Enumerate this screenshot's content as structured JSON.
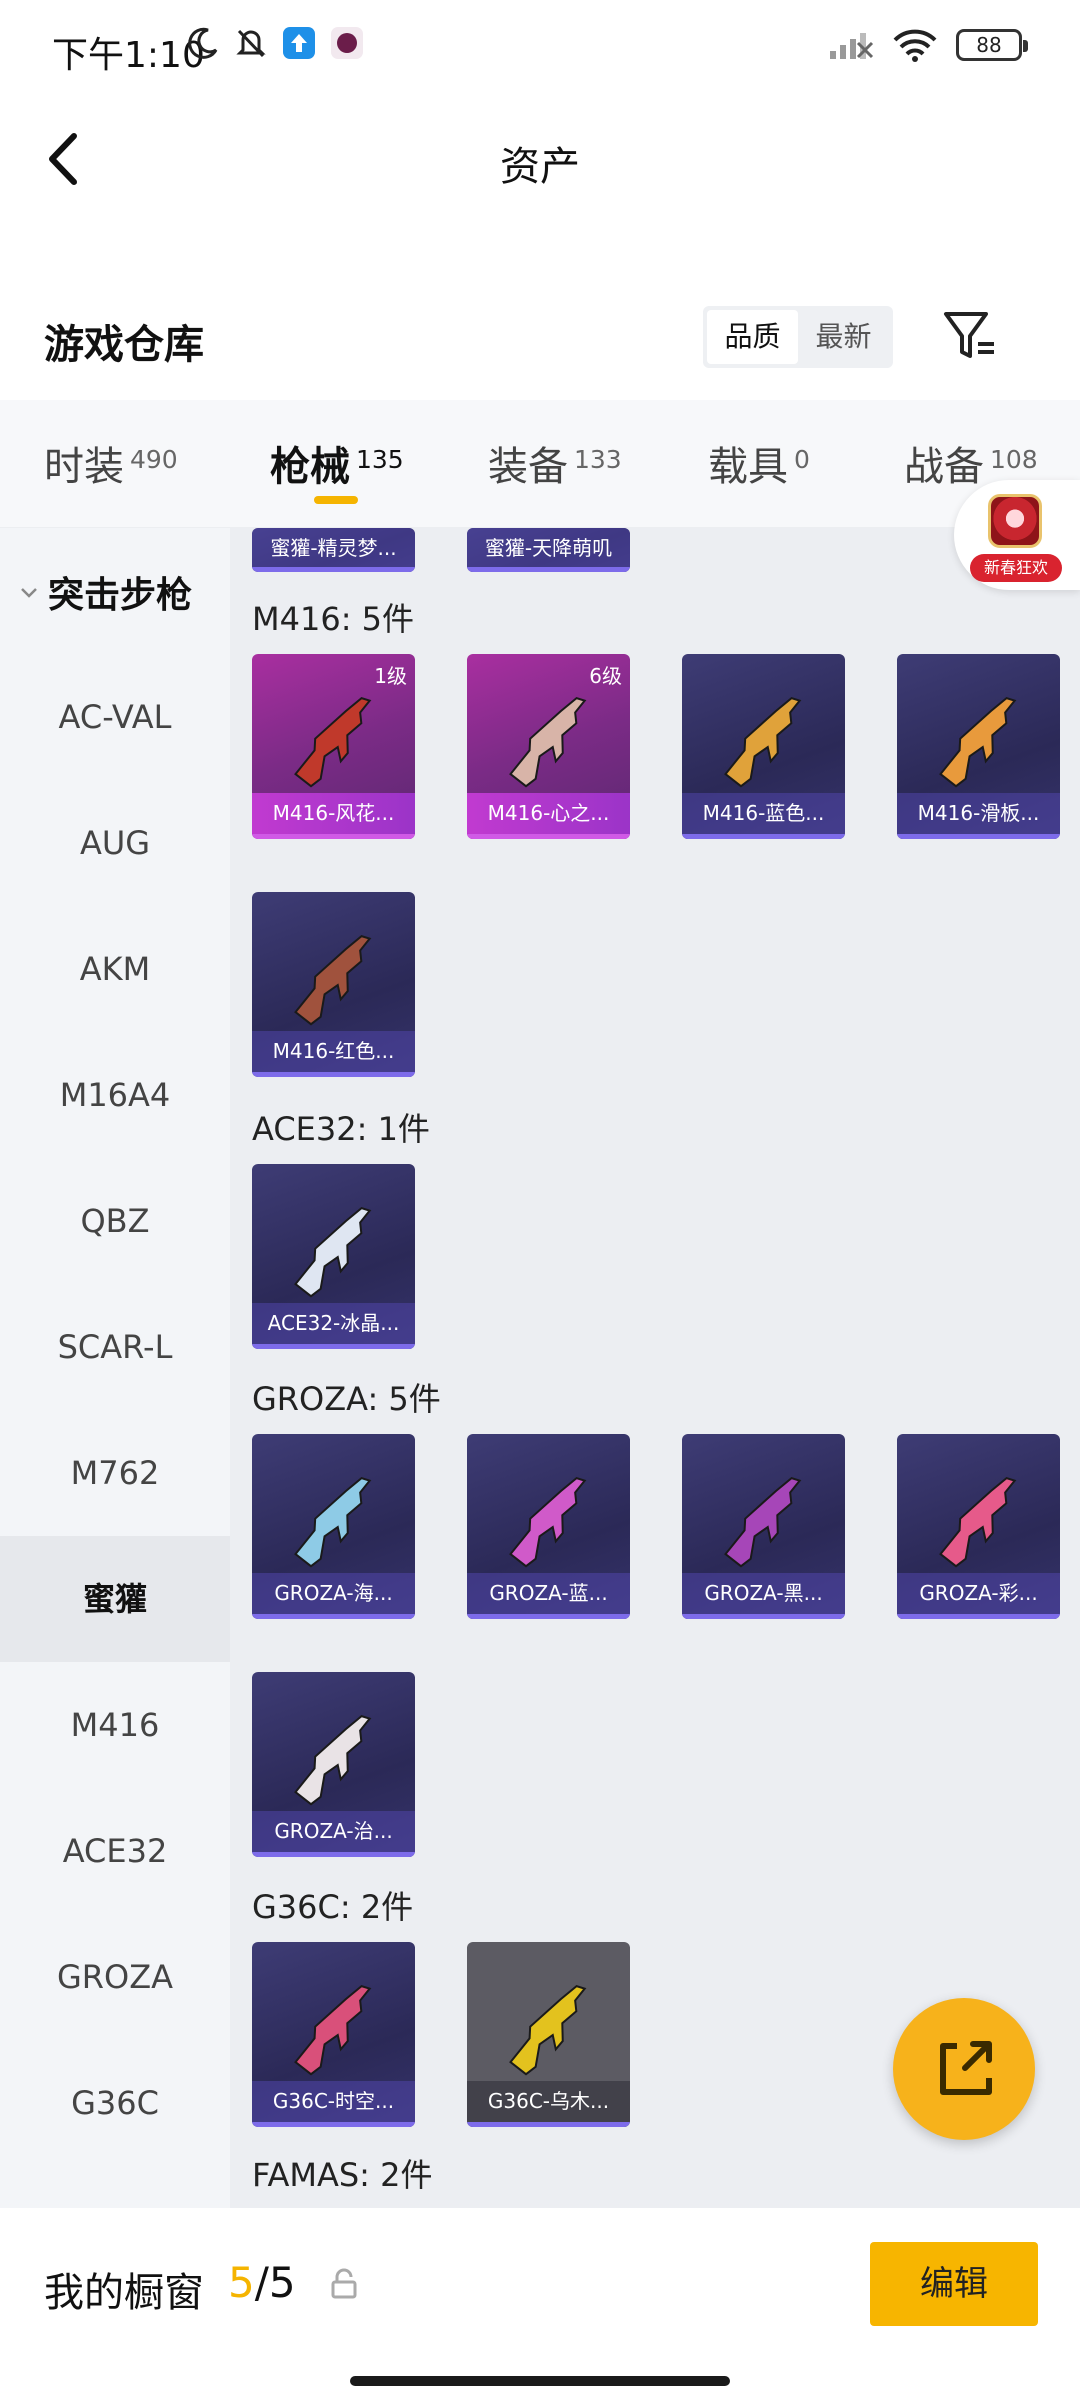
{
  "status_bar": {
    "time": "下午1:10",
    "battery": "88"
  },
  "header": {
    "title": "资产"
  },
  "repo": {
    "title": "游戏仓库",
    "sort_quality": "品质",
    "sort_newest": "最新"
  },
  "tabs": [
    {
      "label": "时装",
      "count": "490"
    },
    {
      "label": "枪械",
      "count": "135"
    },
    {
      "label": "装备",
      "count": "133"
    },
    {
      "label": "载具",
      "count": "0"
    },
    {
      "label": "战备",
      "count": "108"
    }
  ],
  "promo": {
    "text": "新春狂欢"
  },
  "sidebar": {
    "group": "突击步枪",
    "items": [
      "AC-VAL",
      "AUG",
      "AKM",
      "M16A4",
      "QBZ",
      "SCAR-L",
      "M762",
      "蜜獾",
      "M416",
      "ACE32",
      "GROZA",
      "G36C"
    ]
  },
  "content": {
    "stubs": [
      "蜜獾-精灵梦...",
      "蜜獾-天降萌叽"
    ],
    "groups": [
      {
        "label": "M416: 5件",
        "cards": [
          {
            "name": "M416-风花...",
            "level": "1级",
            "style": "pink",
            "gun_color": "#c0392b"
          },
          {
            "name": "M416-心之...",
            "level": "6级",
            "style": "pink",
            "gun_color": "#d8b4a8"
          },
          {
            "name": "M416-蓝色...",
            "level": "",
            "style": "blue",
            "gun_color": "#e0a23a"
          },
          {
            "name": "M416-滑板...",
            "level": "",
            "style": "blue",
            "gun_color": "#e89a3c"
          },
          {
            "name": "M416-红色...",
            "level": "",
            "style": "blue",
            "gun_color": "#a0523d"
          }
        ]
      },
      {
        "label": "ACE32: 1件",
        "cards": [
          {
            "name": "ACE32-冰晶...",
            "level": "",
            "style": "blue",
            "gun_color": "#dfe6f2"
          }
        ]
      },
      {
        "label": "GROZA: 5件",
        "cards": [
          {
            "name": "GROZA-海...",
            "level": "",
            "style": "blue",
            "gun_color": "#8ecbe6"
          },
          {
            "name": "GROZA-蓝...",
            "level": "",
            "style": "blue",
            "gun_color": "#d05ac9"
          },
          {
            "name": "GROZA-黑...",
            "level": "",
            "style": "blue",
            "gun_color": "#a646b8"
          },
          {
            "name": "GROZA-彩...",
            "level": "",
            "style": "blue",
            "gun_color": "#e65a8a"
          },
          {
            "name": "GROZA-治...",
            "level": "",
            "style": "blue",
            "gun_color": "#e9e3e6"
          }
        ]
      },
      {
        "label": "G36C: 2件",
        "cards": [
          {
            "name": "G36C-时空...",
            "level": "",
            "style": "blue",
            "gun_color": "#d9507a"
          },
          {
            "name": "G36C-乌木...",
            "level": "",
            "style": "gray",
            "gun_color": "#e3c21e"
          }
        ]
      },
      {
        "label": "FAMAS: 2件",
        "cards": []
      }
    ]
  },
  "bottom_bar": {
    "showcase_label": "我的橱窗",
    "current": "5",
    "total": "/5",
    "edit_label": "编辑"
  },
  "colors": {
    "accent": "#f5b400",
    "card_bg": "#2b2957",
    "rare_bg": "#a92fa0"
  }
}
